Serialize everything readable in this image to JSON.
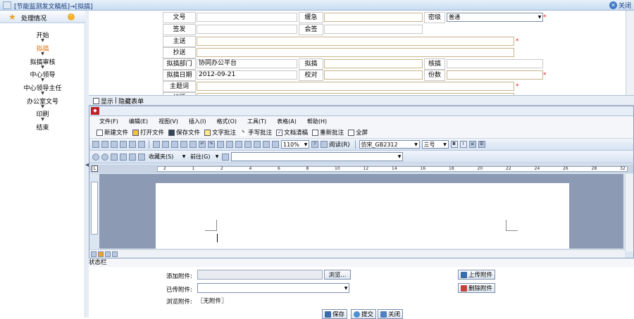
{
  "window": {
    "title": "[节能监测发文稿纸]→[拟搞]",
    "close_label": "关闭"
  },
  "sidebar": {
    "header": "处理情况",
    "steps": [
      "开始",
      "拟搞",
      "拟搞审核",
      "中心领导",
      "中心领导主任",
      "办公室文号",
      "印刷",
      "结束"
    ],
    "active_step": "拟搞"
  },
  "form": {
    "doc_no_label": "文号",
    "urgency_label": "缓急",
    "secret_label": "密级",
    "secret_value": "普通",
    "sign_label": "签发",
    "cosign_label": "会签",
    "to_label": "主送",
    "cc_label": "抄送",
    "dept_label": "拟搞部门",
    "dept_value": "协同办公平台",
    "drafter_label": "拟搞",
    "checker_label": "核搞",
    "date_label": "拟搞日期",
    "date_value": "2012-09-21",
    "proof_label": "校对",
    "copies_label": "份数",
    "subject_label": "主题词",
    "title_label": "标题"
  },
  "tabs": {
    "show": "显示",
    "hide": "隐藏表单"
  },
  "editor": {
    "menu": [
      "文件(F)",
      "编辑(E)",
      "视图(V)",
      "插入(I)",
      "格式(O)",
      "工具(T)",
      "表格(A)",
      "帮助(H)"
    ],
    "commands": [
      "新建文件",
      "打开文件",
      "保存文件",
      "文字批注",
      "手写批注",
      "文档清稿",
      "重新批注",
      "全屏"
    ],
    "zoom": "110%",
    "read_label": "阅读(R)",
    "font": "仿宋_GB2312",
    "size": "三号",
    "favorites": "收藏夹(S)",
    "goto": "前往(G)",
    "ruler_ticks": [
      "2",
      "1",
      "2",
      "4",
      "6",
      "8",
      "10",
      "12",
      "14",
      "16",
      "18",
      "20",
      "22",
      "24",
      "26",
      "28",
      "32"
    ]
  },
  "status_bar": "状态栏",
  "attachments": {
    "add_label": "添加附件:",
    "browse": "浏览...",
    "uploaded_label": "已传附件:",
    "browse_label": "浏览附件:",
    "none": "〖无附件〗",
    "upload_btn": "上传附件",
    "delete_btn": "删除附件"
  },
  "actions": {
    "save": "保存",
    "submit": "提交",
    "close": "关闭"
  }
}
